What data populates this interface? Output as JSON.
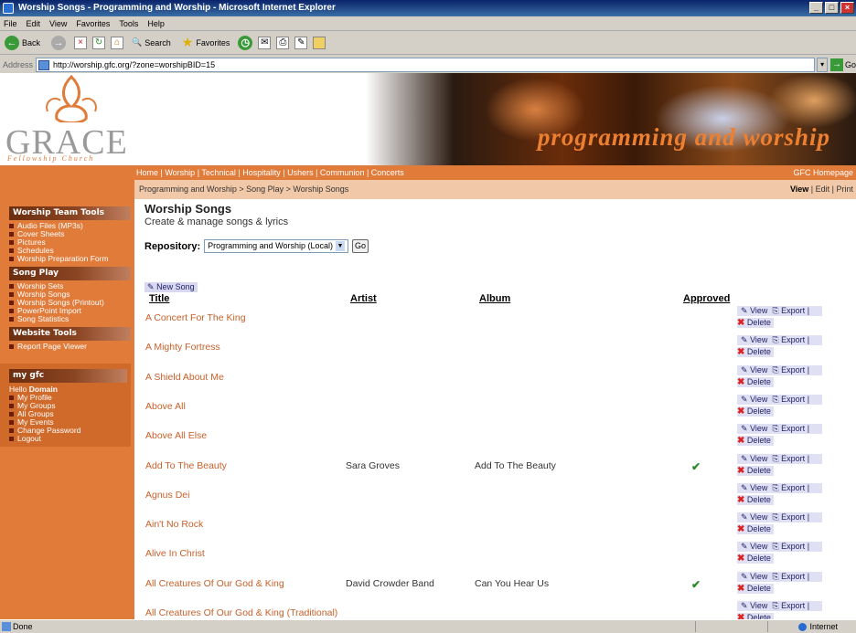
{
  "window": {
    "title": "Worship Songs - Programming and Worship - Microsoft Internet Explorer"
  },
  "menu": [
    "File",
    "Edit",
    "View",
    "Favorites",
    "Tools",
    "Help"
  ],
  "toolbar": {
    "back": "Back",
    "search": "Search",
    "favorites": "Favorites"
  },
  "address": {
    "label": "Address",
    "url": "http://worship.gfc.org/?zone=worshipBID=15",
    "go": "Go"
  },
  "header": {
    "logo_text": "GRACE",
    "logo_sub": "Fellowship Church",
    "banner_title": "programming and worship"
  },
  "nav": {
    "links": "Home | Worship | Technical | Hospitality | Ushers | Communion | Concerts",
    "gfc_home": "GFC Homepage"
  },
  "breadcrumb": {
    "path": "Programming and Worship > Song Play > Worship Songs",
    "view": "View",
    "edit_print": " | Edit | Print"
  },
  "sidebar": {
    "sections": [
      {
        "title": "Worship Team Tools",
        "items": [
          "Audio Files (MP3s)",
          "Cover Sheets",
          "Pictures",
          "Schedules",
          "Worship Preparation Form"
        ]
      },
      {
        "title": "Song Play",
        "items": [
          "Worship Sets",
          "Worship Songs",
          "Worship Songs (Printout)",
          "PowerPoint Import",
          "Song Statistics"
        ]
      },
      {
        "title": "Website Tools",
        "items": [
          "Report Page Viewer"
        ]
      }
    ],
    "mygfc": {
      "title": "my gfc",
      "hello": "Hello",
      "user": "Domain",
      "items": [
        "My Profile",
        "My Groups",
        "All Groups",
        "My Events",
        "Change Password",
        "Logout"
      ]
    }
  },
  "main": {
    "title": "Worship Songs",
    "subtitle": "Create & manage songs & lyrics",
    "repository_label": "Repository:",
    "repository_value": "Programming and Worship (Local)",
    "go": "Go",
    "new_song": "New Song",
    "columns": {
      "title": "Title",
      "artist": "Artist",
      "album": "Album",
      "approved": "Approved"
    },
    "actions": {
      "view": "View",
      "export": "Export",
      "sep": "|",
      "delete": "Delete"
    },
    "songs": [
      {
        "title": "A Concert For The King",
        "artist": "",
        "album": "",
        "approved": ""
      },
      {
        "title": "A Mighty Fortress",
        "artist": "",
        "album": "",
        "approved": ""
      },
      {
        "title": "A Shield About Me",
        "artist": "",
        "album": "",
        "approved": ""
      },
      {
        "title": "Above All",
        "artist": "",
        "album": "",
        "approved": ""
      },
      {
        "title": "Above All Else",
        "artist": "",
        "album": "",
        "approved": ""
      },
      {
        "title": "Add To The Beauty",
        "artist": "Sara Groves",
        "album": "Add To The Beauty",
        "approved": "✔"
      },
      {
        "title": "Agnus Dei",
        "artist": "",
        "album": "",
        "approved": ""
      },
      {
        "title": "Ain't No Rock",
        "artist": "",
        "album": "",
        "approved": ""
      },
      {
        "title": "Alive In Christ",
        "artist": "",
        "album": "",
        "approved": ""
      },
      {
        "title": "All Creatures Of Our God & King",
        "artist": "David Crowder Band",
        "album": "Can You Hear Us",
        "approved": "✔"
      },
      {
        "title": "All Creatures Of Our God & King (Traditional)",
        "artist": "",
        "album": "",
        "approved": ""
      }
    ]
  },
  "status": {
    "left": "Done",
    "zone": "Internet"
  }
}
